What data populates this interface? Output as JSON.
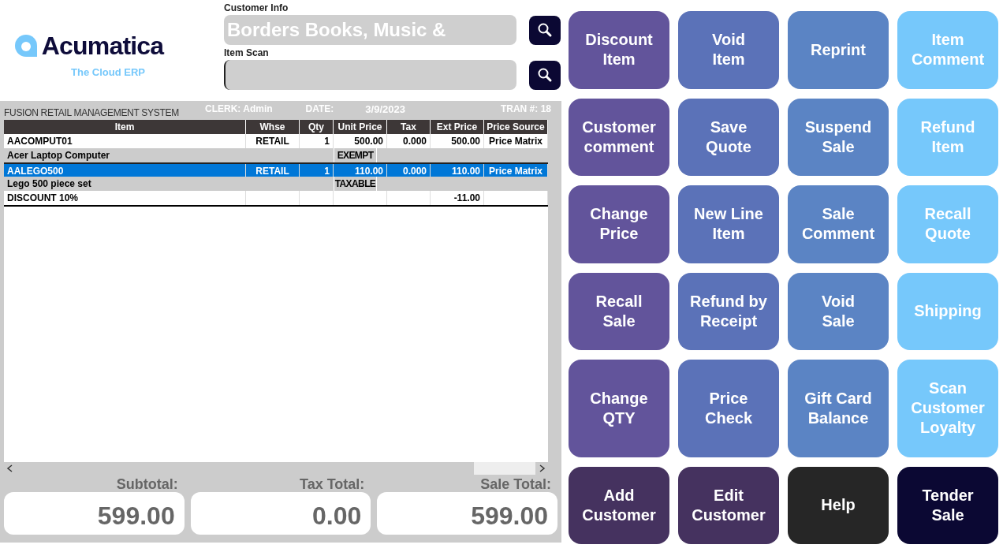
{
  "logo": {
    "name": "Acumatica",
    "tagline": "The Cloud ERP"
  },
  "customer_info": {
    "label": "Customer Info",
    "value": "Borders Books, Music &"
  },
  "item_scan": {
    "label": "Item Scan"
  },
  "sale_header": {
    "system": "FUSION RETAIL MANAGEMENT SYSTEM",
    "clerk_label": "CLERK:",
    "clerk": "Admin",
    "date_label": "DATE:",
    "date": "3/9/2023",
    "tran_label": "TRAN #:",
    "tran": "18"
  },
  "table": {
    "columns": [
      "Item",
      "Whse",
      "Qty",
      "Unit Price",
      "Tax",
      "Ext Price",
      "Price Source"
    ],
    "rows": [
      {
        "kind": "item",
        "selected": false,
        "cells": [
          "AACOMPUT01",
          "RETAIL",
          "1",
          "500.00",
          "0.000",
          "500.00",
          "Price Matrix"
        ],
        "description": "Acer Laptop Computer",
        "tax_status": "EXEMPT"
      },
      {
        "kind": "item",
        "selected": true,
        "cells": [
          "AALEGO500",
          "RETAIL",
          "1",
          "110.00",
          "0.000",
          "110.00",
          "Price Matrix"
        ],
        "description": "Lego 500 piece set",
        "tax_status": "TAXABLE"
      },
      {
        "kind": "discount",
        "selected": false,
        "cells": [
          "DISCOUNT 10%",
          "",
          "",
          "",
          "",
          "-11.00",
          ""
        ]
      }
    ]
  },
  "totals": [
    {
      "label": "Subtotal:",
      "value": "599.00"
    },
    {
      "label": "Tax Total:",
      "value": "0.00"
    },
    {
      "label": "Sale Total:",
      "value": "599.00"
    }
  ],
  "buttons": [
    {
      "lines": [
        "Discount",
        "Item"
      ],
      "color": "#62549b"
    },
    {
      "lines": [
        "Void",
        "Item"
      ],
      "color": "#5b72b8"
    },
    {
      "lines": [
        "Reprint"
      ],
      "color": "#5b84c4"
    },
    {
      "lines": [
        "Item",
        "Comment"
      ],
      "color": "#76c8fb"
    },
    {
      "lines": [
        "Customer",
        "comment"
      ],
      "color": "#62549b"
    },
    {
      "lines": [
        "Save",
        "Quote"
      ],
      "color": "#5b72b8"
    },
    {
      "lines": [
        "Suspend",
        "Sale"
      ],
      "color": "#5b84c4"
    },
    {
      "lines": [
        "Refund",
        "Item"
      ],
      "color": "#76c8fb"
    },
    {
      "lines": [
        "Change",
        "Price"
      ],
      "color": "#62549b"
    },
    {
      "lines": [
        "New Line",
        "Item"
      ],
      "color": "#5b72b8"
    },
    {
      "lines": [
        "Sale",
        "Comment"
      ],
      "color": "#5b84c4"
    },
    {
      "lines": [
        "Recall",
        "Quote"
      ],
      "color": "#76c8fb"
    },
    {
      "lines": [
        "Recall",
        "Sale"
      ],
      "color": "#62549b"
    },
    {
      "lines": [
        "Refund by",
        "Receipt"
      ],
      "color": "#5b72b8"
    },
    {
      "lines": [
        "Void",
        "Sale"
      ],
      "color": "#5b84c4"
    },
    {
      "lines": [
        "Shipping"
      ],
      "color": "#76c8fb"
    },
    {
      "lines": [
        "Change",
        "QTY"
      ],
      "color": "#62549b"
    },
    {
      "lines": [
        "Price",
        "Check"
      ],
      "color": "#5b72b8"
    },
    {
      "lines": [
        "Gift Card",
        "Balance"
      ],
      "color": "#5b84c4"
    },
    {
      "lines": [
        "Scan",
        "Customer",
        "Loyalty"
      ],
      "color": "#76c8fb"
    },
    {
      "lines": [
        "Add",
        "Customer"
      ],
      "color": "#45325f"
    },
    {
      "lines": [
        "Edit",
        "Customer"
      ],
      "color": "#45325f"
    },
    {
      "lines": [
        "Help"
      ],
      "color": "#262626"
    },
    {
      "lines": [
        "Tender",
        "Sale"
      ],
      "color": "#0b0833"
    }
  ]
}
